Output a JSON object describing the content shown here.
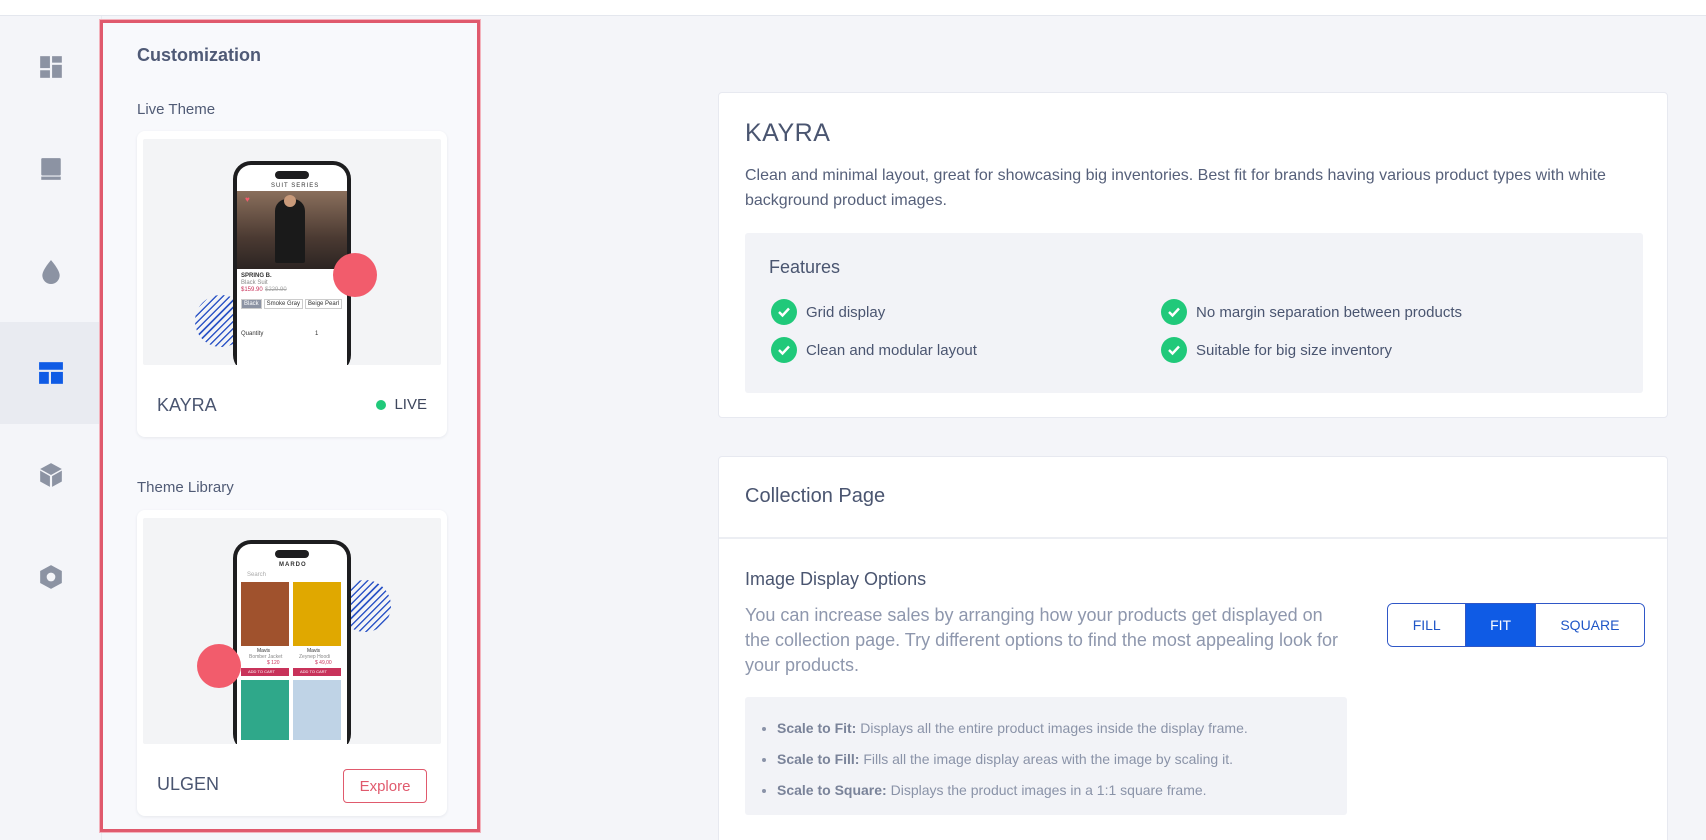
{
  "rail": {
    "items": [
      {
        "name": "dashboard"
      },
      {
        "name": "book"
      },
      {
        "name": "drop"
      },
      {
        "name": "layout",
        "active": true
      },
      {
        "name": "cube"
      },
      {
        "name": "hexagon-settings"
      }
    ],
    "active_color": "#0f5be5"
  },
  "panel": {
    "title": "Customization",
    "live_label": "Live Theme",
    "library_label": "Theme Library",
    "live_theme": {
      "name": "KAYRA",
      "status": "LIVE",
      "preview": {
        "brand": "SUIT SERIES",
        "product": "SPRING B.",
        "subtitle": "Black Suit",
        "price": "$159.90",
        "old_price": "$229.90",
        "sizes": [
          "Black",
          "Smoke Gray",
          "Beige Pearl"
        ],
        "qty_label": "Quantity",
        "qty": "1"
      }
    },
    "library_theme": {
      "name": "ULGEN",
      "button": "Explore",
      "preview": {
        "brand": "MARDO",
        "search": "Search",
        "items": [
          {
            "title": "Mavis",
            "sub": "Bomber Jacket",
            "price": "$ 120",
            "old": "$ 150,00"
          },
          {
            "title": "Mavis",
            "sub": "Zeynep Hoodi",
            "price": "$ 49,00",
            "old": "$ 60,00"
          }
        ],
        "cta": "ADD TO CART"
      }
    }
  },
  "kayra": {
    "title": "KAYRA",
    "description": "Clean and minimal layout, great for showcasing big inventories. Best fit for brands having various product types with white background product images.",
    "features_title": "Features",
    "features": [
      "Grid display",
      "No margin separation between products",
      "Clean and modular layout",
      "Suitable for big size inventory"
    ]
  },
  "collection": {
    "title": "Collection Page",
    "option_title": "Image Display Options",
    "option_desc": "You can increase sales by arranging how your products get displayed on the collection page. Try different options to find the most appealing look for your products.",
    "buttons": [
      "FILL",
      "FIT",
      "SQUARE"
    ],
    "selected": "FIT",
    "scales": [
      {
        "term": "Scale to Fit:",
        "text": " Displays all the entire product images inside the display frame."
      },
      {
        "term": "Scale to Fill:",
        "text": " Fills all the image display areas with the image by scaling it."
      },
      {
        "term": "Scale to Square:",
        "text": " Displays the product images in a 1:1 square frame."
      }
    ]
  }
}
